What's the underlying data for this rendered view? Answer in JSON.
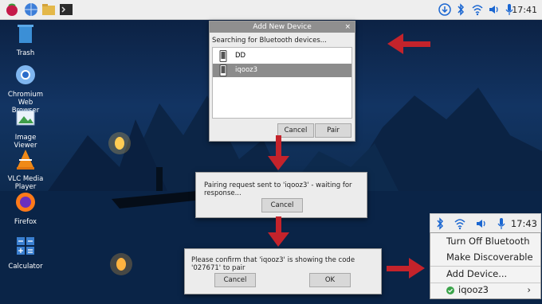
{
  "taskbar": {
    "clock": "17:41"
  },
  "desktop": {
    "icons": [
      {
        "label": "Trash"
      },
      {
        "label": "Chromium Web Browser"
      },
      {
        "label": "Image Viewer"
      },
      {
        "label": "VLC Media Player"
      },
      {
        "label": "Firefox"
      },
      {
        "label": "Calculator"
      }
    ]
  },
  "add_device_dialog": {
    "title": "Add New Device",
    "status": "Searching for Bluetooth devices...",
    "devices": [
      "DD",
      "iqooz3"
    ],
    "cancel_label": "Cancel",
    "pair_label": "Pair"
  },
  "pairing_dialog": {
    "message": "Pairing request sent to 'iqooz3' - waiting for response...",
    "cancel_label": "Cancel"
  },
  "confirm_dialog": {
    "message": "Please confirm that 'iqooz3' is showing the code '027671' to pair",
    "cancel_label": "Cancel",
    "ok_label": "OK"
  },
  "bt_menu": {
    "clock": "17:43",
    "items": [
      "Turn Off Bluetooth",
      "Make Discoverable",
      "Add Device...",
      "iqooz3"
    ]
  },
  "colors": {
    "arrow": "#c4232b",
    "selected_row": "#8c8c8c",
    "accent": "#1a66d1"
  }
}
